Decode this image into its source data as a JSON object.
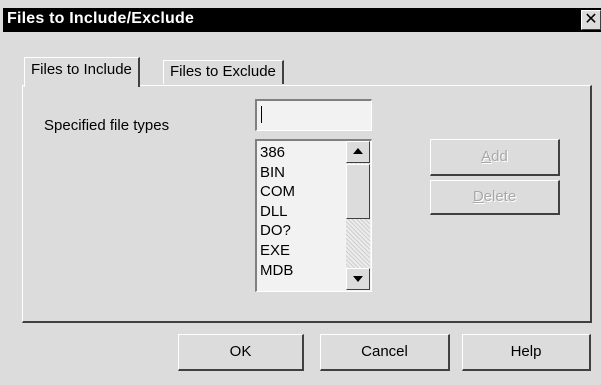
{
  "window": {
    "title": "Files to Include/Exclude",
    "close_glyph": "✕"
  },
  "tabs": [
    {
      "label": "Files to Include",
      "selected": true
    },
    {
      "label": "Files to Exclude",
      "selected": false
    }
  ],
  "include_panel": {
    "file_types_label": "Specified file types",
    "file_type_input": {
      "value": "",
      "placeholder": ""
    },
    "file_types_list": [
      "386",
      "BIN",
      "COM",
      "DLL",
      "DO?",
      "EXE",
      "MDB"
    ],
    "add_button": {
      "mnemonic": "A",
      "rest": "dd",
      "enabled": false
    },
    "delete_button": {
      "mnemonic": "D",
      "rest": "elete",
      "enabled": false
    }
  },
  "footer": {
    "ok_label": "OK",
    "cancel_label": "Cancel",
    "help_label": "Help"
  },
  "icons": {
    "close": "close-icon",
    "scroll_up": "scroll-up-arrow-icon",
    "scroll_down": "scroll-down-arrow-icon"
  }
}
